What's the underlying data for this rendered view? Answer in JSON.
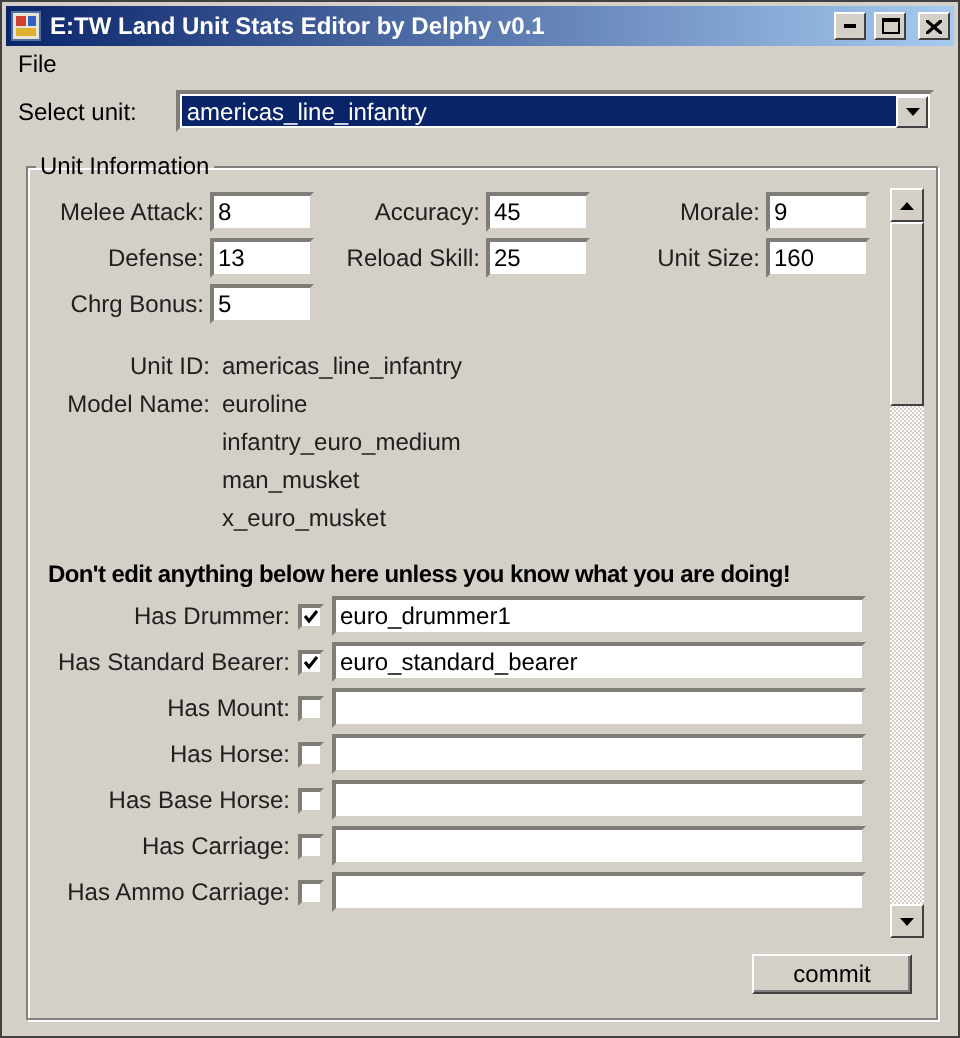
{
  "window": {
    "title": "E:TW Land Unit Stats Editor by Delphy v0.1"
  },
  "menu": [
    "File"
  ],
  "select_unit": {
    "label": "Select unit:",
    "value": "americas_line_infantry"
  },
  "group": {
    "title": "Unit Information",
    "stats": [
      [
        {
          "label": "Melee Attack:",
          "value": "8"
        },
        {
          "label": "Accuracy:",
          "value": "45"
        },
        {
          "label": "Morale:",
          "value": "9"
        }
      ],
      [
        {
          "label": "Defense:",
          "value": "13"
        },
        {
          "label": "Reload Skill:",
          "value": "25"
        },
        {
          "label": "Unit Size:",
          "value": "160"
        }
      ],
      [
        {
          "label": "Chrg Bonus:",
          "value": "5"
        }
      ]
    ],
    "unit_id": {
      "label": "Unit ID:",
      "value": "americas_line_infantry"
    },
    "model_name": {
      "label": "Model Name:",
      "values": [
        "euroline",
        "infantry_euro_medium",
        "man_musket",
        "x_euro_musket"
      ]
    },
    "warning": "Don't edit anything below here unless you know what you are doing!",
    "flags": [
      {
        "label": "Has Drummer:",
        "checked": true,
        "value": "euro_drummer1"
      },
      {
        "label": "Has Standard Bearer:",
        "checked": true,
        "value": "euro_standard_bearer"
      },
      {
        "label": "Has Mount:",
        "checked": false
      },
      {
        "label": "Has Horse:",
        "checked": false
      },
      {
        "label": "Has Base Horse:",
        "checked": false
      },
      {
        "label": "Has Carriage:",
        "checked": false
      },
      {
        "label": "Has Ammo Carriage:",
        "checked": false
      }
    ]
  },
  "commit": "commit"
}
